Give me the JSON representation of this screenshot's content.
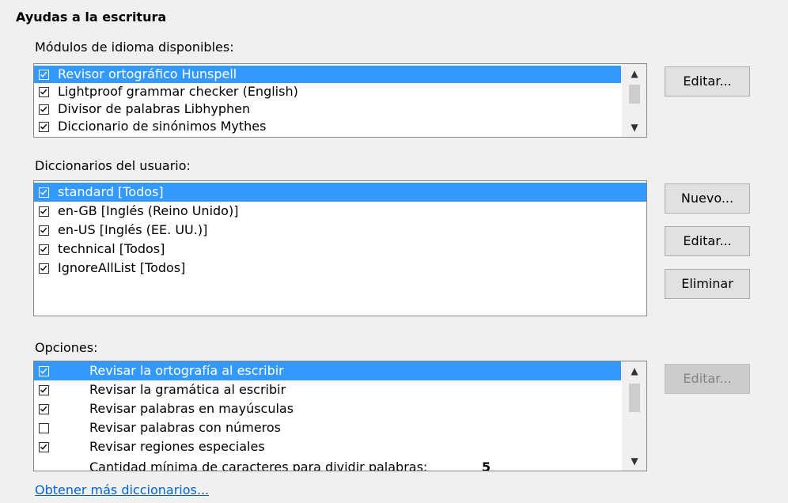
{
  "section_title": "Ayudas a la escritura",
  "modules": {
    "label": "Módulos de idioma disponibles:",
    "items": [
      {
        "label": "Revisor ortográfico Hunspell",
        "checked": true,
        "selected": true
      },
      {
        "label": "Lightproof grammar checker (English)",
        "checked": true,
        "selected": false
      },
      {
        "label": "Divisor de palabras Libhyphen",
        "checked": true,
        "selected": false
      },
      {
        "label": "Diccionario de sinónimos Mythes",
        "checked": true,
        "selected": false
      }
    ],
    "edit_button": "Editar..."
  },
  "user_dictionaries": {
    "label": "Diccionarios del usuario:",
    "items": [
      {
        "label": "standard [Todos]",
        "checked": true,
        "selected": true
      },
      {
        "label": "en-GB [Inglés (Reino Unido)]",
        "checked": true,
        "selected": false
      },
      {
        "label": "en-US [Inglés (EE. UU.)]",
        "checked": true,
        "selected": false
      },
      {
        "label": "technical [Todos]",
        "checked": true,
        "selected": false
      },
      {
        "label": "IgnoreAllList [Todos]",
        "checked": true,
        "selected": false
      }
    ],
    "new_button": "Nuevo...",
    "edit_button": "Editar...",
    "delete_button": "Eliminar"
  },
  "options": {
    "label": "Opciones:",
    "items": [
      {
        "label": "Revisar la ortografía al escribir",
        "checked": true,
        "selected": true
      },
      {
        "label": "Revisar la gramática al escribir",
        "checked": true,
        "selected": false
      },
      {
        "label": "Revisar palabras en mayúsculas",
        "checked": true,
        "selected": false
      },
      {
        "label": "Revisar palabras con números",
        "checked": false,
        "selected": false
      },
      {
        "label": "Revisar regiones especiales",
        "checked": true,
        "selected": false
      }
    ],
    "min_chars_label": "Cantidad mínima de caracteres para dividir palabras:",
    "min_chars_value": "5",
    "edit_button": "Editar..."
  },
  "more_dictionaries_link": "Obtener más diccionarios..."
}
